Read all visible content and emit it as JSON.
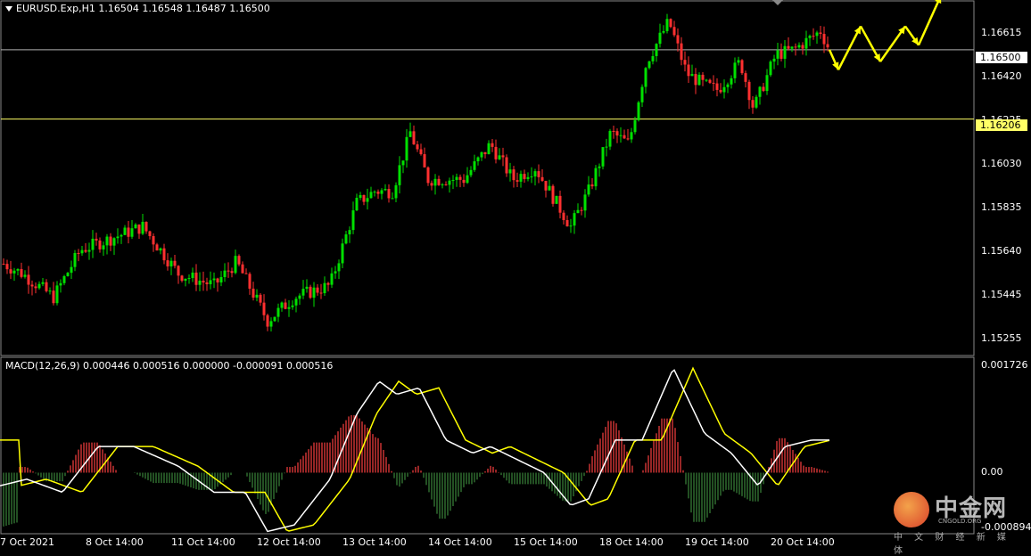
{
  "main_header": {
    "symbol_line": "EURUSD.Exp,H1  1.16504 1.16548 1.16487 1.16500"
  },
  "macd_header": {
    "text": "MACD(12,26,9) 0.000446 0.000516 0.000000 -0.000091 0.000516"
  },
  "price_axis": {
    "labels": [
      "1.16615",
      "1.16420",
      "1.16225",
      "1.16030",
      "1.15835",
      "1.15640",
      "1.15445",
      "1.15255"
    ],
    "current_price_tag": "1.16500",
    "level_tag": "1.16206"
  },
  "macd_axis": {
    "labels": [
      "0.001726",
      "0.00",
      "-0.000894"
    ]
  },
  "time_axis": {
    "labels": [
      "7 Oct 2021",
      "8 Oct 14:00",
      "11 Oct 14:00",
      "12 Oct 14:00",
      "13 Oct 14:00",
      "14 Oct 14:00",
      "15 Oct 14:00",
      "18 Oct 14:00",
      "19 Oct 14:00",
      "20 Oct 14:00"
    ]
  },
  "watermark": {
    "name_cn": "中金网",
    "name_en": "CNGOLD.ORG",
    "tagline": "中 文 财 经 新 媒 体"
  },
  "colors": {
    "background": "#000000",
    "bull_candle": "#00e000",
    "bear_candle": "#ff3030",
    "level_line": "#ffff66",
    "current_price_line": "#b0b0b0",
    "forecast_arrow": "#ffff00",
    "macd_line": "#ffffff",
    "signal_line": "#ffff00",
    "hist_positive": "#c83232",
    "hist_negative": "#2f6b2f"
  },
  "chart_data": {
    "type": "candlestick",
    "symbol": "EURUSD.Exp",
    "timeframe": "H1",
    "ylim": [
      1.1521,
      1.167
    ],
    "horizontal_lines": [
      1.165,
      1.16206
    ],
    "forecast_path": [
      1.165,
      1.16415,
      1.166,
      1.1645,
      1.166,
      1.1652,
      1.1673
    ],
    "macd": {
      "params": "12,26,9",
      "ylim": [
        -0.000894,
        0.001726
      ]
    }
  }
}
